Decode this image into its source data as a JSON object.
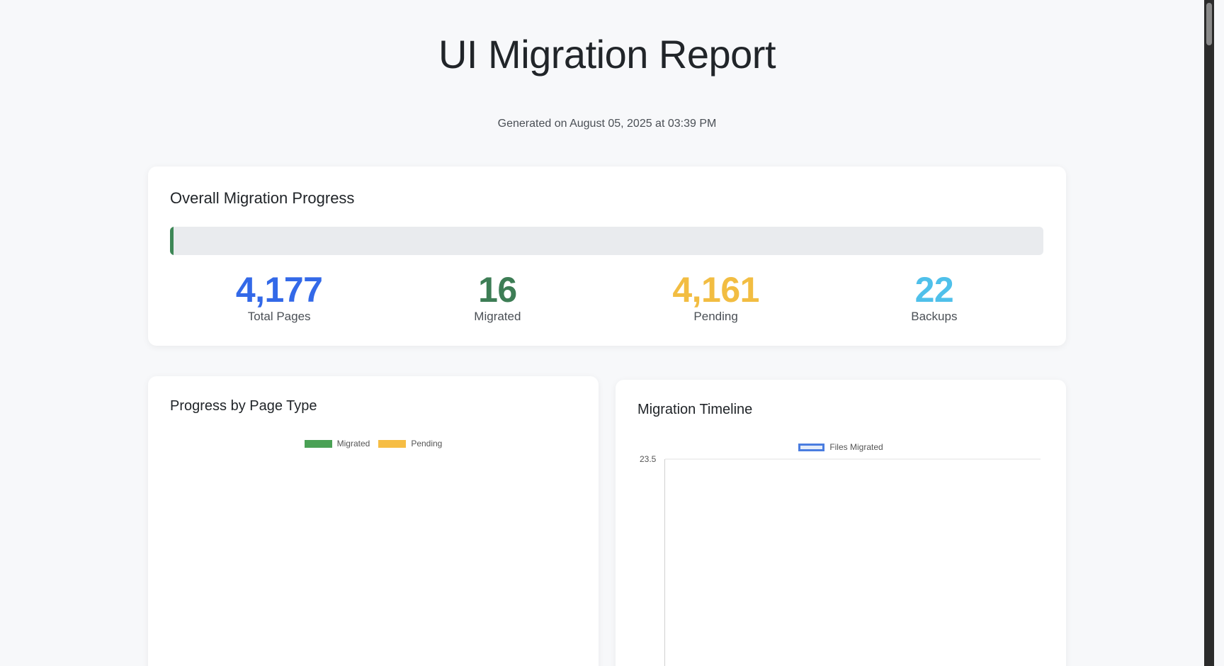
{
  "header": {
    "title": "UI Migration Report",
    "generated": "Generated on August 05, 2025 at 03:39 PM"
  },
  "overall": {
    "title": "Overall Migration Progress",
    "progress_fraction": 0.0038,
    "fill_color": "#3d8756",
    "stats": [
      {
        "value": "4,177",
        "label": "Total Pages",
        "color": "#3369e8"
      },
      {
        "value": "16",
        "label": "Migrated",
        "color": "#3d7d55"
      },
      {
        "value": "4,161",
        "label": "Pending",
        "color": "#f2bd42"
      },
      {
        "value": "22",
        "label": "Backups",
        "color": "#4fc0ea"
      }
    ]
  },
  "type_chart": {
    "title": "Progress by Page Type",
    "legend": [
      {
        "label": "Migrated",
        "color": "#4aa155"
      },
      {
        "label": "Pending",
        "color": "#f6bd44"
      }
    ]
  },
  "timeline_chart": {
    "title": "Migration Timeline",
    "legend": [
      {
        "label": "Files Migrated",
        "color": "#4a7de0"
      }
    ]
  },
  "chart_data": [
    {
      "type": "bar",
      "title": "Progress by Page Type",
      "series": [
        {
          "name": "Migrated",
          "values": []
        },
        {
          "name": "Pending",
          "values": []
        }
      ],
      "categories": []
    },
    {
      "type": "line",
      "title": "Migration Timeline",
      "series": [
        {
          "name": "Files Migrated",
          "values": []
        }
      ],
      "y_ticks": [
        "23.5"
      ]
    }
  ]
}
